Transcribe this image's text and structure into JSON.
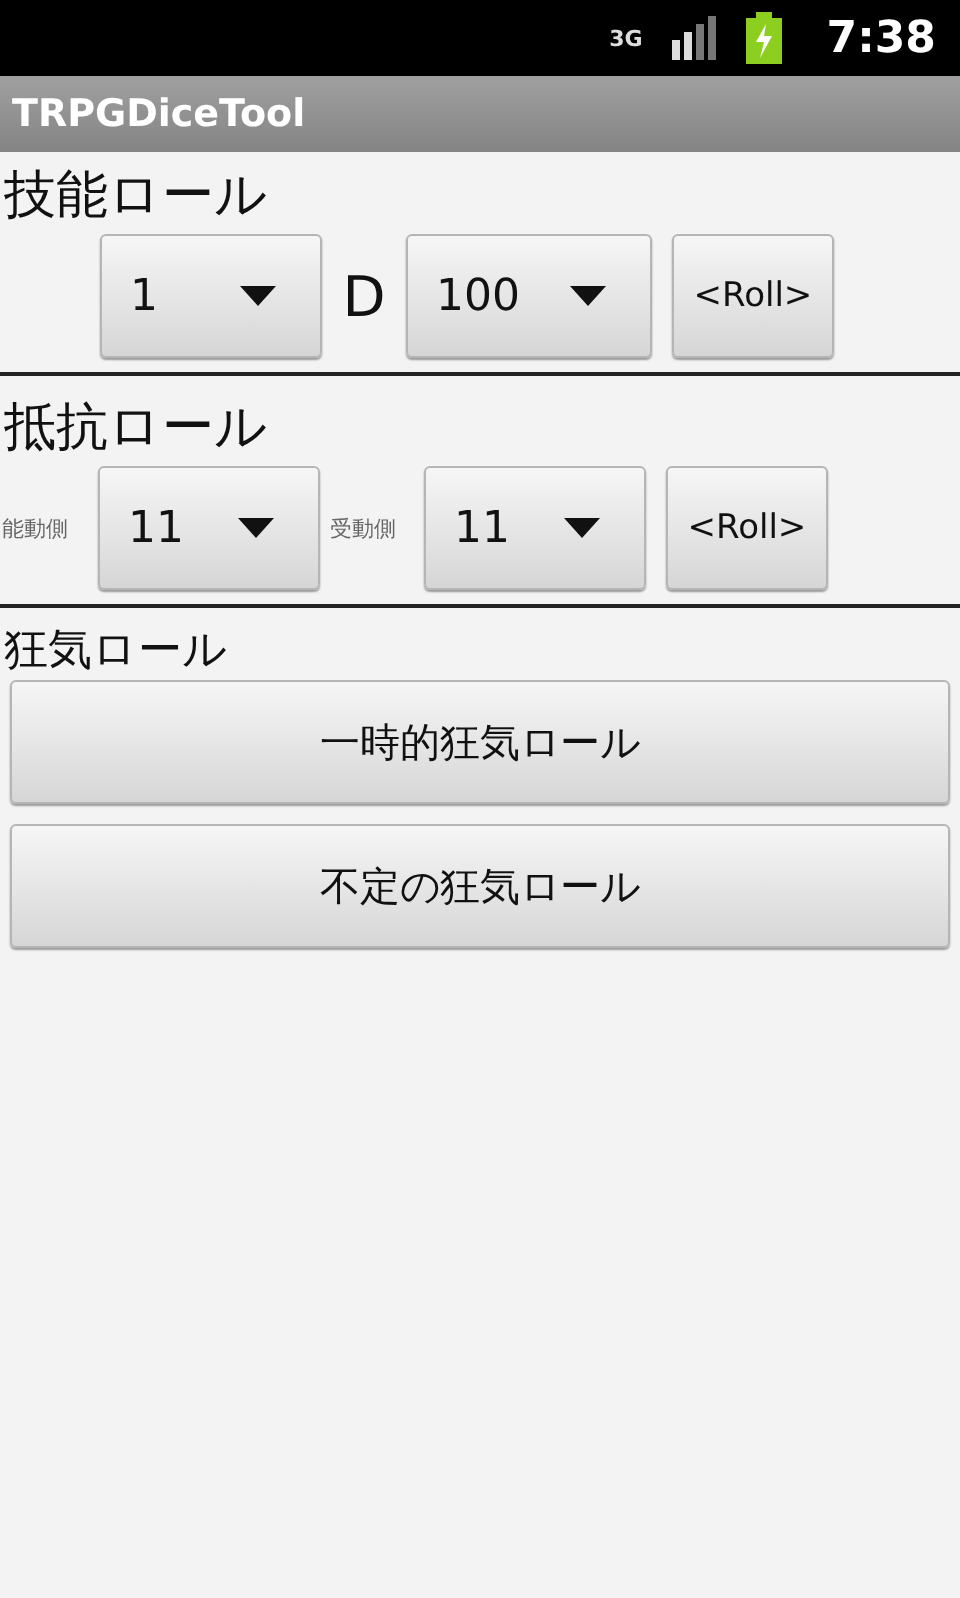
{
  "status_bar": {
    "network": "3G",
    "time": "7:38"
  },
  "app_bar": {
    "title": "TRPGDiceTool"
  },
  "skill_roll": {
    "heading": "技能ロール",
    "dice_count": "1",
    "separator": "D",
    "dice_sides": "100",
    "roll_button": "<Roll>"
  },
  "resist_roll": {
    "heading": "抵抗ロール",
    "active_label": "能動側",
    "active_value": "11",
    "passive_label": "受動側",
    "passive_value": "11",
    "roll_button": "<Roll>"
  },
  "sanity_roll": {
    "heading": "狂気ロール",
    "buttons": [
      "一時的狂気ロール",
      "不定の狂気ロール"
    ]
  }
}
